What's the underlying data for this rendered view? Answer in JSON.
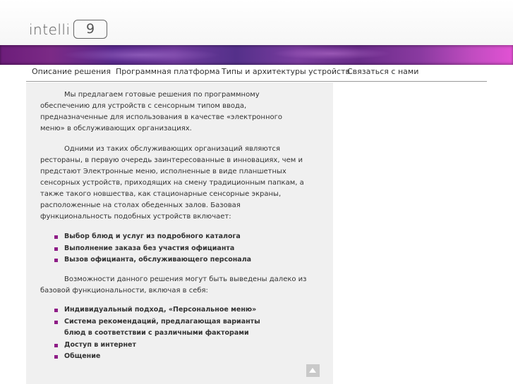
{
  "header": {
    "logo_text": "intelli",
    "logo_number": "9"
  },
  "nav": {
    "items": [
      {
        "label": "Описание решения"
      },
      {
        "label": "Программная платформа"
      },
      {
        "label": "Типы и архитектуры устройств"
      },
      {
        "label": "Связаться с нами"
      }
    ]
  },
  "content": {
    "paragraphs": [
      "Мы предлагаем готовые решения по программному обеспечению для устройств с сенсорным типом ввода, предназначенные для использования в качестве «электронного меню» в обслуживающих организациях.",
      "Одними из таких обслуживающих организаций являются рестораны, в первую очередь заинтересованные в инновациях, чем и предстают Электронные меню, исполненные в виде планшетных сенсорных устройств, приходящих на смену традиционным папкам, а также такого новшества, как стационарные сенсорные экраны, расположенные на столах обеденных залов. Базовая функциональность подобных устройств включает:",
      "Возможности данного решения могут быть выведены далеко из базовой функциональности, включая в себя:"
    ],
    "list1": [
      "Выбор блюд и услуг из подробного каталога",
      "Выполнение заказа без участия официанта",
      "Вызов официанта, обслуживающего персонала"
    ],
    "list2": [
      "Индивидуальный подход, «Персональное меню»",
      "Система рекомендаций, предлагающая варианты блюд в соответствии с различными факторами",
      "Доступ в интернет",
      "Общение"
    ]
  },
  "colors": {
    "bullet": "#8e1c86",
    "banner": "#6c1d7a",
    "panel": "#f0f0f0"
  },
  "icons": {
    "scroll_top": "triangle-up-icon"
  }
}
